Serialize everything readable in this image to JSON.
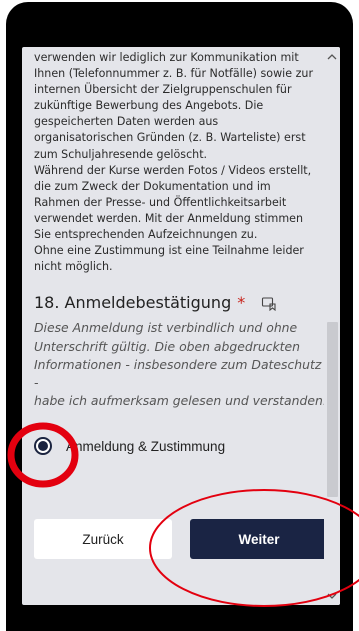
{
  "form": {
    "privacy_text": "verwenden wir lediglich zur Kommunikation mit\nIhnen (Telefonnummer z. B. für Notfälle) sowie zur\ninternen Übersicht der Zielgruppenschulen für\nzukünftige Bewerbung des Angebots. Die\ngespeicherten Daten werden aus\norganisatorischen Gründen (z. B. Warteliste) erst\nzum Schuljahresende gelöscht.\nWährend der Kurse werden Fotos / Videos erstellt,\ndie zum Zweck der Dokumentation und im\nRahmen der Presse- und Öffentlichkeitsarbeit\nverwendet werden. Mit der Anmeldung stimmen\nSie entsprechenden Aufzeichnungen zu.\nOhne eine Zustimmung ist eine Teilnahme leider\nnicht möglich.",
    "question": {
      "title": "18. Anmeldebestätigung",
      "required_mark": "*",
      "description": "Diese Anmeldung ist verbindlich und ohne\nUnterschrift gültig. Die oben abgedruckten\nInformationen - insbesondere zum Dateschutz -\nhabe ich aufmerksam gelesen und verstanden.",
      "option_label": "Anmeldung & Zustimmung",
      "option_selected": true
    },
    "buttons": {
      "back": "Zurück",
      "next": "Weiter"
    }
  },
  "colors": {
    "phone_frame": "#000000",
    "screen_bg": "#e4e5ea",
    "primary_button": "#1a2444",
    "required": "#c8231b",
    "annotation": "#e3000f"
  },
  "icons": {
    "translate": "immersive-reader-icon",
    "scroll_up": "chevron-up-icon",
    "scroll_down": "chevron-down-icon"
  }
}
